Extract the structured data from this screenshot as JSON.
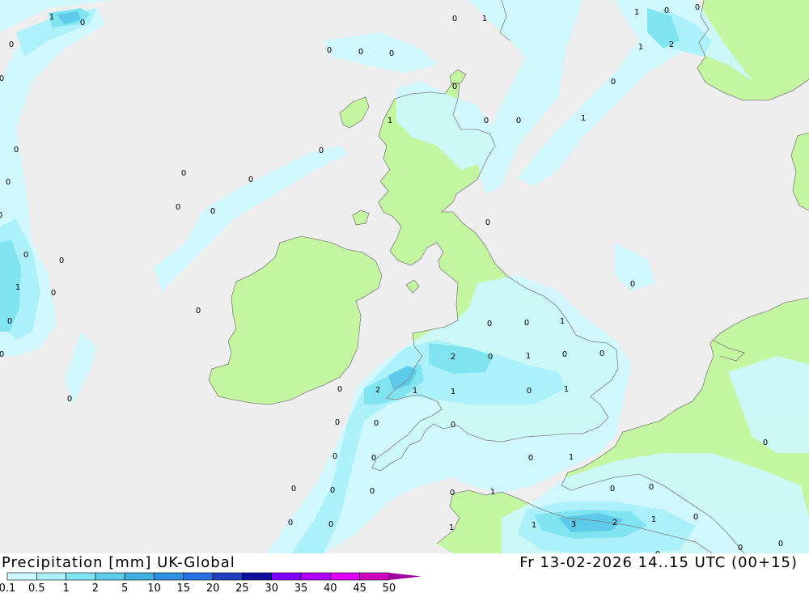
{
  "title": {
    "product": "Precipitation [mm] UK-Global",
    "valid_time": "Fr 13-02-2026 14..15 UTC (00+15)"
  },
  "legend": {
    "levels": [
      "0.1",
      "0.5",
      "1",
      "2",
      "5",
      "10",
      "15",
      "20",
      "25",
      "30",
      "35",
      "40",
      "45",
      "50"
    ],
    "colors": [
      "#ccf8ff",
      "#aaf0fa",
      "#80e4f0",
      "#5ccae8",
      "#40b0e0",
      "#3090e0",
      "#2a70e0",
      "#2040c0",
      "#1010a0",
      "#8000ff",
      "#b000ff",
      "#e000ff",
      "#d000c0",
      "#a000a0"
    ]
  },
  "colors": {
    "sea": "#eeeeee",
    "land": "#c4f5a0",
    "coast": "#808080"
  },
  "contour_labels": [
    {
      "text": "1",
      "pos": [
        64,
        20
      ]
    },
    {
      "text": "0",
      "pos": [
        102,
        27
      ]
    },
    {
      "text": "0",
      "pos": [
        14,
        54
      ]
    },
    {
      "text": "0",
      "pos": [
        2,
        96
      ]
    },
    {
      "text": "0",
      "pos": [
        20,
        184
      ]
    },
    {
      "text": "0",
      "pos": [
        10,
        224
      ]
    },
    {
      "text": "0",
      "pos": [
        0,
        265
      ]
    },
    {
      "text": "0",
      "pos": [
        32,
        314
      ]
    },
    {
      "text": "0",
      "pos": [
        76,
        321
      ]
    },
    {
      "text": "1",
      "pos": [
        22,
        354
      ]
    },
    {
      "text": "0",
      "pos": [
        66,
        361
      ]
    },
    {
      "text": "0",
      "pos": [
        12,
        396
      ]
    },
    {
      "text": "0",
      "pos": [
        2,
        437
      ]
    },
    {
      "text": "0",
      "pos": [
        86,
        492
      ]
    },
    {
      "text": "0",
      "pos": [
        562,
        22
      ]
    },
    {
      "text": "1",
      "pos": [
        599,
        22
      ]
    },
    {
      "text": "1",
      "pos": [
        787,
        14
      ]
    },
    {
      "text": "0",
      "pos": [
        824,
        12
      ]
    },
    {
      "text": "0",
      "pos": [
        862,
        8
      ]
    },
    {
      "text": "1",
      "pos": [
        792,
        57
      ]
    },
    {
      "text": "2",
      "pos": [
        830,
        54
      ]
    },
    {
      "text": "0",
      "pos": [
        407,
        61
      ]
    },
    {
      "text": "0",
      "pos": [
        446,
        63
      ]
    },
    {
      "text": "0",
      "pos": [
        484,
        65
      ]
    },
    {
      "text": "0",
      "pos": [
        562,
        106
      ]
    },
    {
      "text": "0",
      "pos": [
        758,
        100
      ]
    },
    {
      "text": "1",
      "pos": [
        482,
        148
      ]
    },
    {
      "text": "0",
      "pos": [
        601,
        148
      ]
    },
    {
      "text": "0",
      "pos": [
        641,
        148
      ]
    },
    {
      "text": "1",
      "pos": [
        721,
        145
      ]
    },
    {
      "text": "0",
      "pos": [
        397,
        185
      ]
    },
    {
      "text": "0",
      "pos": [
        227,
        213
      ]
    },
    {
      "text": "0",
      "pos": [
        310,
        221
      ]
    },
    {
      "text": "0",
      "pos": [
        220,
        255
      ]
    },
    {
      "text": "0",
      "pos": [
        263,
        260
      ]
    },
    {
      "text": "0",
      "pos": [
        603,
        274
      ]
    },
    {
      "text": "0",
      "pos": [
        782,
        350
      ]
    },
    {
      "text": "0",
      "pos": [
        245,
        383
      ]
    },
    {
      "text": "0",
      "pos": [
        605,
        399
      ]
    },
    {
      "text": "0",
      "pos": [
        651,
        398
      ]
    },
    {
      "text": "1",
      "pos": [
        695,
        396
      ]
    },
    {
      "text": "2",
      "pos": [
        560,
        440
      ]
    },
    {
      "text": "0",
      "pos": [
        606,
        440
      ]
    },
    {
      "text": "1",
      "pos": [
        653,
        439
      ]
    },
    {
      "text": "0",
      "pos": [
        698,
        437
      ]
    },
    {
      "text": "0",
      "pos": [
        744,
        436
      ]
    },
    {
      "text": "0",
      "pos": [
        420,
        480
      ]
    },
    {
      "text": "2",
      "pos": [
        467,
        481
      ]
    },
    {
      "text": "1",
      "pos": [
        513,
        482
      ]
    },
    {
      "text": "1",
      "pos": [
        560,
        483
      ]
    },
    {
      "text": "0",
      "pos": [
        654,
        482
      ]
    },
    {
      "text": "1",
      "pos": [
        700,
        480
      ]
    },
    {
      "text": "0",
      "pos": [
        417,
        521
      ]
    },
    {
      "text": "0",
      "pos": [
        465,
        522
      ]
    },
    {
      "text": "0",
      "pos": [
        560,
        524
      ]
    },
    {
      "text": "0",
      "pos": [
        946,
        546
      ]
    },
    {
      "text": "0",
      "pos": [
        414,
        563
      ]
    },
    {
      "text": "0",
      "pos": [
        462,
        565
      ]
    },
    {
      "text": "0",
      "pos": [
        656,
        565
      ]
    },
    {
      "text": "1",
      "pos": [
        706,
        564
      ]
    },
    {
      "text": "0",
      "pos": [
        363,
        603
      ]
    },
    {
      "text": "0",
      "pos": [
        411,
        605
      ]
    },
    {
      "text": "0",
      "pos": [
        460,
        606
      ]
    },
    {
      "text": "0",
      "pos": [
        559,
        608
      ]
    },
    {
      "text": "1",
      "pos": [
        609,
        607
      ]
    },
    {
      "text": "0",
      "pos": [
        757,
        603
      ]
    },
    {
      "text": "0",
      "pos": [
        805,
        601
      ]
    },
    {
      "text": "0",
      "pos": [
        359,
        645
      ]
    },
    {
      "text": "0",
      "pos": [
        409,
        647
      ]
    },
    {
      "text": "1",
      "pos": [
        558,
        651
      ]
    },
    {
      "text": "1",
      "pos": [
        660,
        648
      ]
    },
    {
      "text": "3",
      "pos": [
        709,
        647
      ]
    },
    {
      "text": "2",
      "pos": [
        760,
        645
      ]
    },
    {
      "text": "1",
      "pos": [
        808,
        641
      ]
    },
    {
      "text": "0",
      "pos": [
        860,
        638
      ]
    },
    {
      "text": "0",
      "pos": [
        915,
        676
      ]
    },
    {
      "text": "0",
      "pos": [
        965,
        671
      ]
    },
    {
      "text": "0",
      "pos": [
        813,
        684
      ]
    }
  ]
}
